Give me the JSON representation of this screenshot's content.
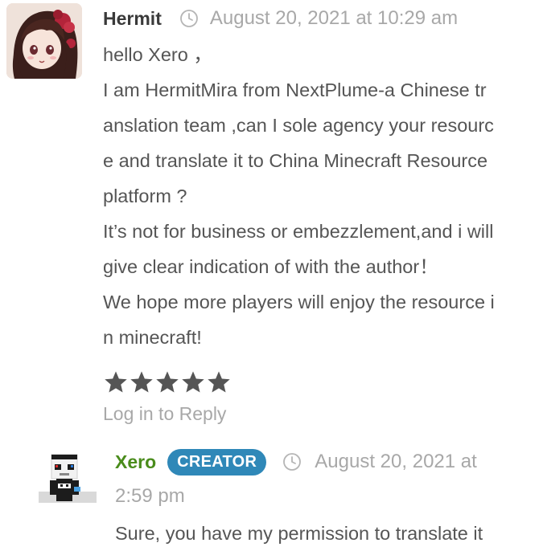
{
  "comments": [
    {
      "author": "Hermit",
      "date": "August 20, 2021 at 10:29 am",
      "lines": [
        "hello Xero ，",
        "I am HermitMira from NextPlume-a Chinese tr",
        "anslation team ,can I sole agency your resourc",
        "e and translate it to China Minecraft Resource",
        "platform ?",
        "It’s not for business or embezzlement,and i will",
        "give clear indication of with the author！",
        "We hope more players will enjoy the resource i",
        "n minecraft!"
      ],
      "rating": 5,
      "reply_label": "Log in to Reply",
      "avatar_icon": "anime-girl-avatar-icon"
    },
    {
      "author": "Xero",
      "badge": "CREATOR",
      "date_part1": "August 20, 2021 at",
      "date_part2": "2:59 pm",
      "body": "Sure, you have my permission to translate it",
      "avatar_icon": "pixel-skin-avatar-icon"
    }
  ],
  "colors": {
    "author_1": "#3a3a3a",
    "author_2": "#4a8c1c",
    "badge_bg": "#2f88b8",
    "meta_text": "#a8a8a8",
    "body_text": "#555555",
    "star": "#555555"
  },
  "icons": [
    "clock-icon",
    "star-icon"
  ]
}
